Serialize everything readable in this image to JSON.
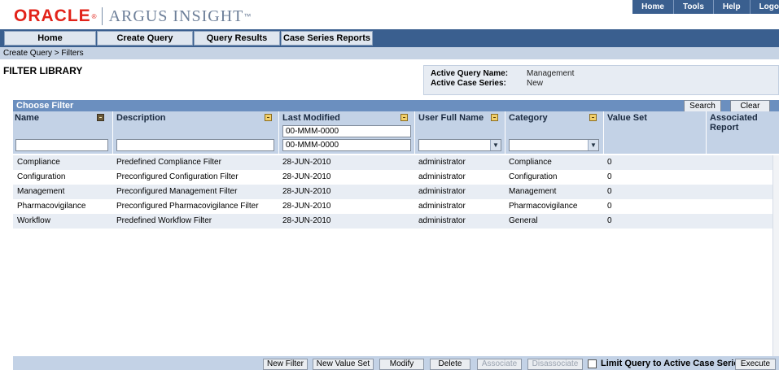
{
  "header": {
    "logo_oracle": "ORACLE",
    "logo_reg": "®",
    "logo_product": "ARGUS INSIGHT",
    "logo_tm": "™",
    "top_links": [
      "Home",
      "Tools",
      "Help",
      "Logo"
    ]
  },
  "nav": {
    "tabs": [
      "Home",
      "Create Query",
      "Query Results",
      "Case Series Reports"
    ]
  },
  "breadcrumb": "Create Query > Filters",
  "page_title": "FILTER LIBRARY",
  "query_info": {
    "query_name_label": "Active Query Name:",
    "query_name_value": "Management",
    "case_series_label": "Active Case Series:",
    "case_series_value": "New"
  },
  "filter_panel": {
    "title": "Choose Filter",
    "search_label": "Search",
    "clear_label": "Clear",
    "columns": [
      "Name",
      "Description",
      "Last Modified",
      "User Full Name",
      "Category",
      "Value Set",
      "Associated Report"
    ],
    "date_from_value": "00-MMM-0000",
    "date_to_value": "00-MMM-0000"
  },
  "rows": [
    {
      "name": "Compliance",
      "description": "Predefined Compliance Filter",
      "modified": "28-JUN-2010",
      "user": "administrator",
      "category": "Compliance",
      "value_set": "0"
    },
    {
      "name": "Configuration",
      "description": "Preconfigured Configuration Filter",
      "modified": "28-JUN-2010",
      "user": "administrator",
      "category": "Configuration",
      "value_set": "0"
    },
    {
      "name": "Management",
      "description": "Preconfigured Management Filter",
      "modified": "28-JUN-2010",
      "user": "administrator",
      "category": "Management",
      "value_set": "0"
    },
    {
      "name": "Pharmacovigilance",
      "description": "Preconfigured Pharmacovigilance Filter",
      "modified": "28-JUN-2010",
      "user": "administrator",
      "category": "Pharmacovigilance",
      "value_set": "0"
    },
    {
      "name": "Workflow",
      "description": "Predefined Workflow Filter",
      "modified": "28-JUN-2010",
      "user": "administrator",
      "category": "General",
      "value_set": "0"
    }
  ],
  "toolbar": {
    "new_filter": "New Filter",
    "new_value_set": "New Value Set",
    "modify": "Modify",
    "delete": "Delete",
    "associate": "Associate",
    "disassociate": "Disassociate",
    "limit_query_label": "Limit Query to Active Case Series",
    "execute": "Execute"
  },
  "colors": {
    "brand_red": "#e2231a",
    "nav_blue": "#3a5f8f",
    "panel_blue": "#6b8fbf",
    "header_row": "#c3d2e6"
  }
}
